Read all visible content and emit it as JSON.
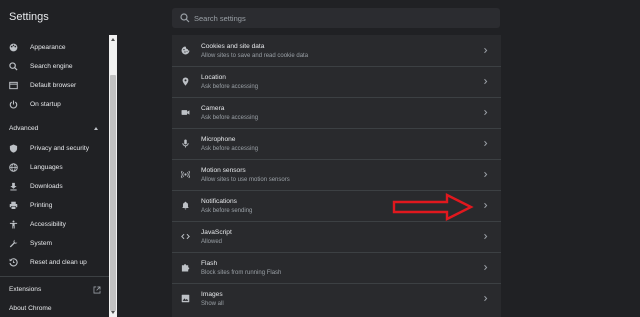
{
  "header": {
    "title": "Settings",
    "search_placeholder": "Search settings"
  },
  "sidebar": {
    "items": [
      {
        "label": "Appearance",
        "icon": "palette-icon"
      },
      {
        "label": "Search engine",
        "icon": "search-icon"
      },
      {
        "label": "Default browser",
        "icon": "browser-icon"
      },
      {
        "label": "On startup",
        "icon": "power-icon"
      }
    ],
    "advanced_label": "Advanced",
    "advanced_items": [
      {
        "label": "Privacy and security",
        "icon": "shield-icon"
      },
      {
        "label": "Languages",
        "icon": "globe-icon"
      },
      {
        "label": "Downloads",
        "icon": "download-icon"
      },
      {
        "label": "Printing",
        "icon": "printer-icon"
      },
      {
        "label": "Accessibility",
        "icon": "accessibility-icon"
      },
      {
        "label": "System",
        "icon": "wrench-icon"
      },
      {
        "label": "Reset and clean up",
        "icon": "reset-icon"
      }
    ],
    "extensions_label": "Extensions",
    "about_label": "About Chrome"
  },
  "site_settings": [
    {
      "title": "Cookies and site data",
      "subtitle": "Allow sites to save and read cookie data",
      "icon": "cookie-icon"
    },
    {
      "title": "Location",
      "subtitle": "Ask before accessing",
      "icon": "location-pin-icon"
    },
    {
      "title": "Camera",
      "subtitle": "Ask before accessing",
      "icon": "camera-icon"
    },
    {
      "title": "Microphone",
      "subtitle": "Ask before accessing",
      "icon": "microphone-icon"
    },
    {
      "title": "Motion sensors",
      "subtitle": "Allow sites to use motion sensors",
      "icon": "motion-sensor-icon"
    },
    {
      "title": "Notifications",
      "subtitle": "Ask before sending",
      "icon": "bell-icon"
    },
    {
      "title": "JavaScript",
      "subtitle": "Allowed",
      "icon": "code-icon"
    },
    {
      "title": "Flash",
      "subtitle": "Block sites from running Flash",
      "icon": "puzzle-icon"
    },
    {
      "title": "Images",
      "subtitle": "Show all",
      "icon": "image-icon"
    }
  ],
  "colors": {
    "background": "#202124",
    "panel": "#292a2d",
    "text": "#e8eaed",
    "secondary_text": "#9aa0a6",
    "annotation_arrow": "#e0181e"
  }
}
